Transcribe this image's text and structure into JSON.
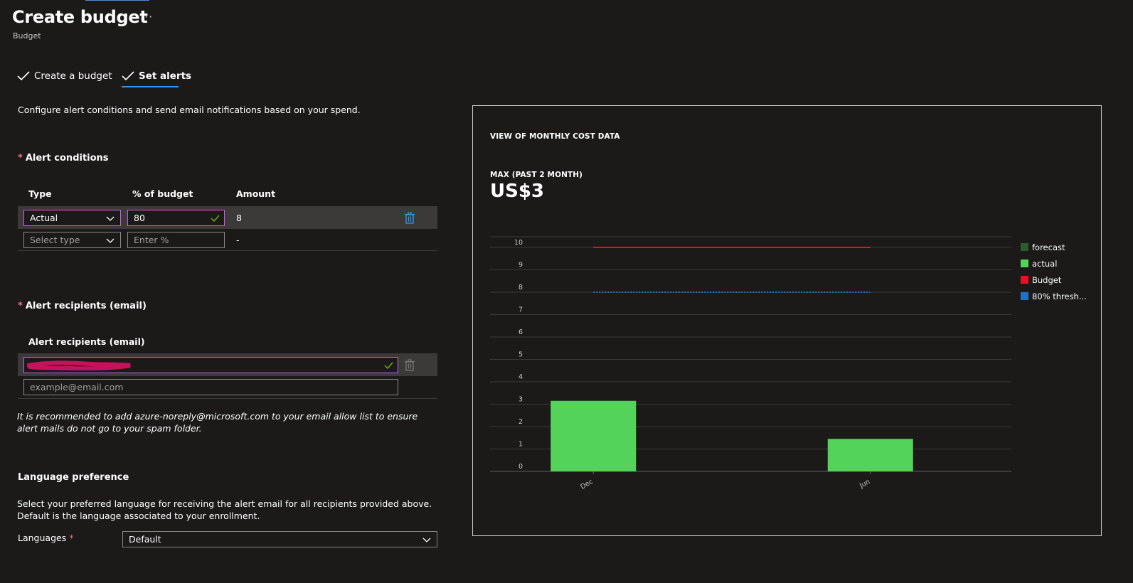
{
  "header": {
    "title": "Create budget",
    "more_label": "···",
    "subtitle": "Budget"
  },
  "tabs": [
    {
      "label": "Create a budget",
      "completed": true
    },
    {
      "label": "Set alerts",
      "completed": true,
      "active": true
    }
  ],
  "description": "Configure alert conditions and send email notifications based on your spend.",
  "alert_conditions": {
    "title": "Alert conditions",
    "required_mark": "*",
    "columns": [
      "Type",
      "% of budget",
      "Amount"
    ],
    "rows": [
      {
        "type": "Actual",
        "percent": "80",
        "amount": "8"
      },
      {
        "type_placeholder": "Select type",
        "percent_placeholder": "Enter %",
        "amount": "-"
      }
    ]
  },
  "alert_recipients": {
    "title": "Alert recipients (email)",
    "required_mark": "*",
    "column": "Alert recipients (email)",
    "email_placeholder": "example@email.com"
  },
  "note": "It is recommended to add azure-noreply@microsoft.com to your email allow list to ensure alert mails do not go to your spam folder.",
  "language": {
    "title": "Language preference",
    "description": "Select your preferred language for receiving the alert email for all recipients provided above. Default is the language associated to your enrollment.",
    "field_label": "Languages",
    "required_mark": "*",
    "value": "Default"
  },
  "colors": {
    "accent": "#2899f5",
    "focus_border": "#c760e6",
    "actual": "#54d35a",
    "forecast": "#2d5a2f",
    "budget": "#e81123",
    "threshold": "#1e73c8"
  },
  "chart_panel": {
    "heading": "VIEW OF MONTHLY COST DATA",
    "max_label": "MAX (PAST 2 MONTH)",
    "max_value": "US$3"
  },
  "chart_data": {
    "type": "bar",
    "categories": [
      "Dec",
      "Jun"
    ],
    "series": [
      {
        "name": "forecast",
        "values": [
          0,
          0
        ]
      },
      {
        "name": "actual",
        "values": [
          3.15,
          1.45
        ]
      },
      {
        "name": "Budget",
        "values": [
          10,
          10
        ]
      },
      {
        "name": "80% thresh...",
        "values": [
          8,
          8
        ]
      }
    ],
    "ylim": [
      0,
      10
    ],
    "yticks": [
      0,
      1,
      2,
      3,
      4,
      5,
      6,
      7,
      8,
      9,
      10
    ],
    "xlabel": "",
    "ylabel": "",
    "grid": true,
    "legend": "right"
  }
}
